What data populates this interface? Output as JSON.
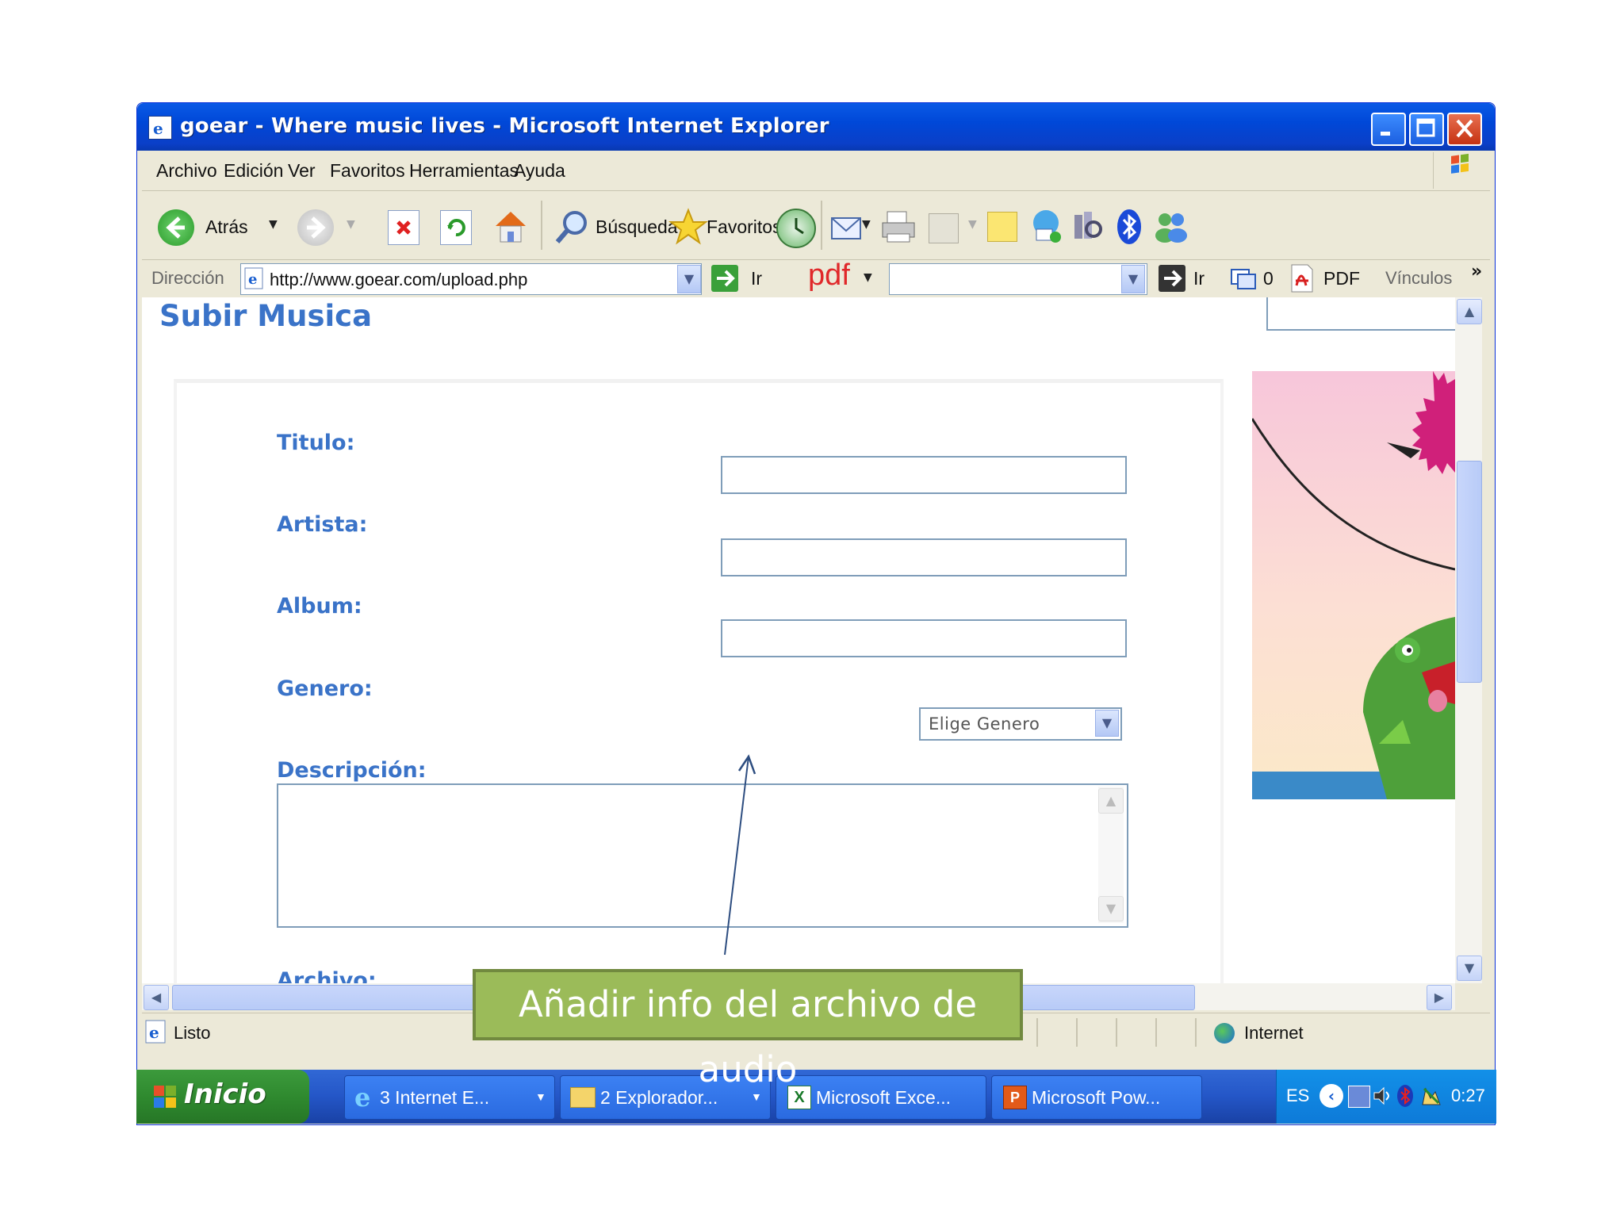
{
  "window": {
    "title": "goear - Where music lives - Microsoft Internet Explorer",
    "controls": [
      "minimize",
      "maximize",
      "close"
    ]
  },
  "menubar": {
    "items": [
      "Archivo",
      "Edición",
      "Ver",
      "Favoritos",
      "Herramientas",
      "Ayuda"
    ]
  },
  "toolbar": {
    "back_label": "Atrás",
    "search_label": "Búsqueda",
    "favorites_label": "Favoritos"
  },
  "addressbar": {
    "label": "Dirección",
    "url": "http://www.goear.com/upload.php",
    "go_label": "Ir",
    "pdf_logo": "pdf",
    "search_go_label": "Ir",
    "popup_count": "0",
    "pdf_label": "PDF",
    "links_label": "Vínculos",
    "more_glyph": "»"
  },
  "page": {
    "title": "Subir Musica",
    "form": {
      "titulo_label": "Titulo:",
      "artista_label": "Artista:",
      "album_label": "Album:",
      "genero_label": "Genero:",
      "genero_selected": "Elige Genero",
      "descripcion_label": "Descripción:",
      "archivo_label": "Archivo:"
    }
  },
  "statusbar": {
    "status": "Listo",
    "zone": "Internet"
  },
  "taskbar": {
    "start_label": "Inicio",
    "tasks": [
      "3 Internet E...",
      "2 Explorador...",
      "Microsoft Exce...",
      "Microsoft Pow..."
    ],
    "language": "ES",
    "clock": "0:27"
  },
  "annotation": {
    "text": "Añadir info del archivo de audio"
  },
  "colors": {
    "titlebar": "#0a5ae6",
    "form_label": "#3a73c8",
    "callout_fill": "#9bbb59",
    "taskbar": "#2456c7",
    "start_button": "#2f8a2f"
  }
}
